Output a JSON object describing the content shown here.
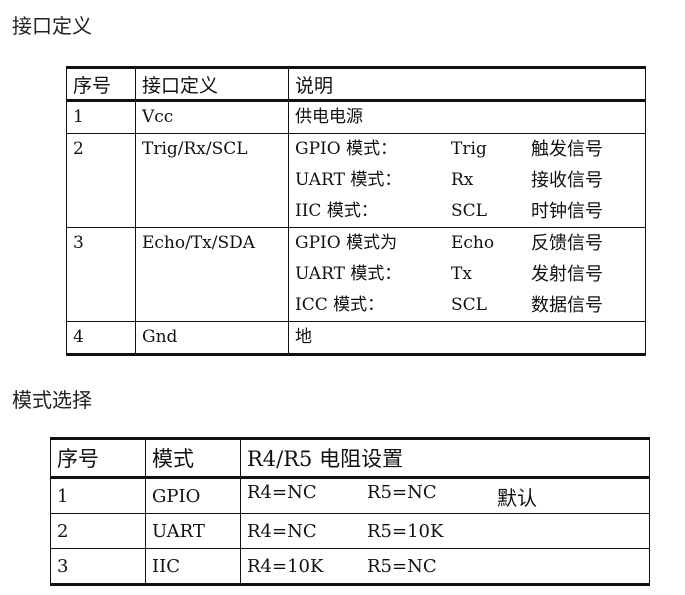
{
  "section1_title": "接口定义",
  "section2_title": "模式选择",
  "interface_table": {
    "headers": [
      "序号",
      "接口定义",
      "说明"
    ],
    "rows": [
      {
        "no": "1",
        "pin": "Vcc",
        "desc": [
          [
            "供电电源",
            "",
            ""
          ]
        ]
      },
      {
        "no": "2",
        "pin": "Trig/Rx/SCL",
        "desc": [
          [
            "GPIO 模式：",
            "Trig",
            "触发信号"
          ],
          [
            "UART 模式：",
            "Rx",
            "接收信号"
          ],
          [
            " IIC 模式：",
            "SCL",
            "时钟信号"
          ]
        ]
      },
      {
        "no": "3",
        "pin": "Echo/Tx/SDA",
        "desc": [
          [
            "GPIO 模式为",
            "Echo",
            "反馈信号"
          ],
          [
            "UART 模式：",
            "Tx",
            "发射信号"
          ],
          [
            " ICC 模式：",
            "SCL",
            "数据信号"
          ]
        ]
      },
      {
        "no": "4",
        "pin": "Gnd",
        "desc": [
          [
            "地",
            "",
            ""
          ]
        ]
      }
    ]
  },
  "mode_table": {
    "headers": [
      "序号",
      "模式",
      "R4/R5 电阻设置"
    ],
    "rows": [
      {
        "no": "1",
        "mode": "GPIO",
        "r4": "R4=NC",
        "r5": "R5=NC",
        "note": "默认"
      },
      {
        "no": "2",
        "mode": "UART",
        "r4": "R4=NC",
        "r5": "R5=10K",
        "note": ""
      },
      {
        "no": "3",
        "mode": "IIC",
        "r4": "R4=10K",
        "r5": "R5=NC",
        "note": ""
      }
    ]
  }
}
